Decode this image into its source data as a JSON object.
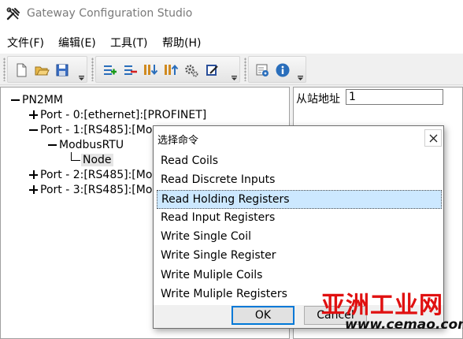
{
  "window": {
    "title": "Gateway Configuration Studio"
  },
  "menu": [
    "文件(F)",
    "编辑(E)",
    "工具(T)",
    "帮助(H)"
  ],
  "toolbar": {
    "group1": [
      "new-file-icon",
      "open-folder-icon",
      "save-icon"
    ],
    "group2": [
      "add-port-icon",
      "delete-port-icon",
      "download-icon",
      "upload-icon",
      "settings-icon",
      "edit-icon"
    ],
    "group3": [
      "monitor-icon",
      "info-icon"
    ]
  },
  "tree": {
    "root": "PN2MM",
    "port0": "Port - 0:[ethernet]:[PROFINET]",
    "port1": "Port - 1:[RS485]:[Mo",
    "protocol": "ModbusRTU",
    "node": "Node",
    "port2": "Port - 2:[RS485]:[Mo",
    "port3": "Port - 3:[RS485]:[Mo"
  },
  "props": {
    "slave_address_label": "从站地址",
    "slave_address_value": "1"
  },
  "dialog": {
    "title": "选择命令",
    "commands": [
      "Read Coils",
      "Read Discrete Inputs",
      "Read Holding Registers",
      "Read Input Registers",
      "Write Single Coil",
      "Write Single Register",
      "Write Muliple Coils",
      "Write Muliple Registers"
    ],
    "selected_index": 2,
    "ok_label": "OK",
    "cancel_label": "Cancel"
  },
  "watermark": {
    "main": "亚洲工业网",
    "sub": "www.cemao.com"
  },
  "colors": {
    "selection": "#cce8ff",
    "watermark": "#e01010",
    "accent": "#0078d7"
  }
}
